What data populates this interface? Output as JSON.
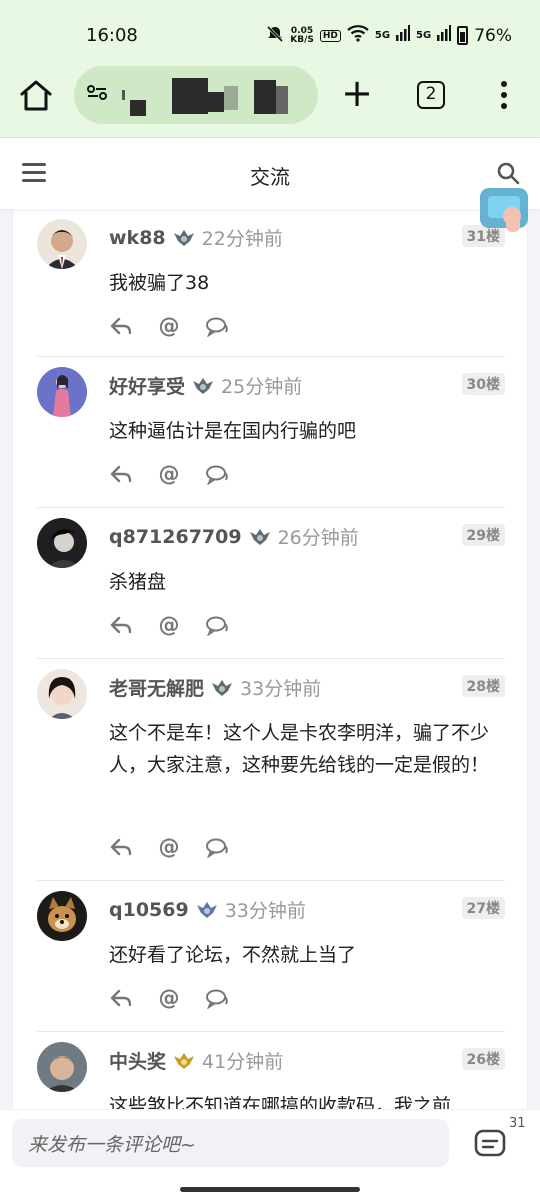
{
  "status_bar": {
    "time": "16:08",
    "net_speed_value": "0.05",
    "net_speed_unit": "KB/S",
    "hd": "HD",
    "signal1": "5G",
    "signal2": "5G",
    "battery": "76%"
  },
  "browser": {
    "tab_count": "2"
  },
  "page": {
    "title": "交流"
  },
  "posts": [
    {
      "username": "wk88",
      "time": "22分钟前",
      "floor": "31楼",
      "text": "我被骗了38",
      "badge_color": "#5d6b72",
      "avatar_color": "#c9a888"
    },
    {
      "username": "好好享受",
      "time": "25分钟前",
      "floor": "30楼",
      "text": "这种逼估计是在国内行骗的吧",
      "badge_color": "#5d6b72",
      "avatar_color": "#6b73c8"
    },
    {
      "username": "q871267709",
      "time": "26分钟前",
      "floor": "29楼",
      "text": "杀猪盘",
      "badge_color": "#5d6b72",
      "avatar_color": "#2f2f33"
    },
    {
      "username": "老哥无解肥",
      "time": "33分钟前",
      "floor": "28楼",
      "text": "这个不是车！这个人是卡农李明洋，骗了不少人，大家注意，这种要先给钱的一定是假的！",
      "badge_color": "#5d6b72",
      "avatar_color": "#d9c2b2"
    },
    {
      "username": "q10569",
      "time": "33分钟前",
      "floor": "27楼",
      "text": "还好看了论坛，不然就上当了",
      "badge_color": "#6a6fa8",
      "avatar_color": "#6b4a2d"
    },
    {
      "username": "中头奖",
      "time": "41分钟前",
      "floor": "26楼",
      "text": "这些煞比不知道在哪搞的收款码，我之前",
      "badge_color": "#c79a2a",
      "avatar_color": "#8a7364"
    }
  ],
  "comment_bar": {
    "placeholder": "来发布一条评论吧~",
    "count": "31"
  },
  "icons": {
    "home": "home-icon",
    "url": "site-info-icon",
    "new_tab": "plus-icon",
    "tabs": "tabs-icon",
    "more": "more-vertical-icon",
    "menu": "hamburger-menu-icon",
    "search": "search-icon",
    "reply": "reply-icon",
    "mention": "at-icon",
    "comment": "comment-bubbles-icon"
  }
}
